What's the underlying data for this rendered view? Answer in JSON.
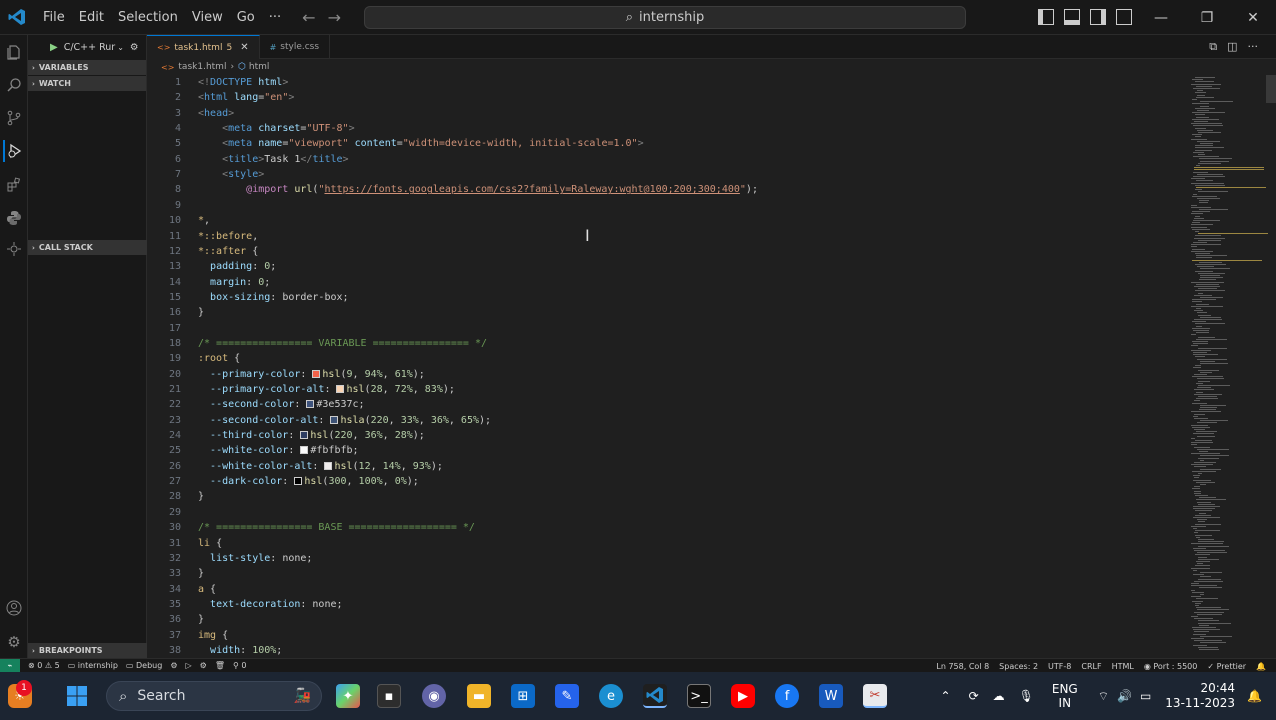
{
  "menu": [
    "File",
    "Edit",
    "Selection",
    "View",
    "Go",
    "···"
  ],
  "search": {
    "text": "internship"
  },
  "run": {
    "label": "C/C++ Rur"
  },
  "sidebar": {
    "sections": [
      {
        "label": "VARIABLES"
      },
      {
        "label": "WATCH"
      },
      {
        "label": "CALL STACK"
      },
      {
        "label": "BREAKPOINTS"
      }
    ]
  },
  "tabs": [
    {
      "label": "task1.html",
      "badge": "5",
      "icon": "html-file-icon",
      "active": true
    },
    {
      "label": "style.css",
      "icon": "css-file-icon",
      "active": false
    }
  ],
  "breadcrumb": {
    "file": "task1.html",
    "node": "html"
  },
  "code_lines": [
    {
      "n": "1",
      "spans": [
        [
          "t-punc",
          "<!"
        ],
        [
          "t-tag",
          "DOCTYPE "
        ],
        [
          "t-attr",
          "html"
        ],
        [
          "t-punc",
          ">"
        ]
      ]
    },
    {
      "n": "2",
      "spans": [
        [
          "t-punc",
          "<"
        ],
        [
          "t-tag",
          "html "
        ],
        [
          "t-attr",
          "lang"
        ],
        [
          "t-txt",
          "="
        ],
        [
          "t-str",
          "\"en\""
        ],
        [
          "t-punc",
          ">"
        ]
      ]
    },
    {
      "n": "3",
      "spans": [
        [
          "t-punc",
          "<"
        ],
        [
          "t-tag",
          "head"
        ],
        [
          "t-punc",
          ">"
        ]
      ]
    },
    {
      "n": "4",
      "spans": [
        [
          "t-txt",
          "    "
        ],
        [
          "t-punc",
          "<"
        ],
        [
          "t-tag",
          "meta "
        ],
        [
          "t-attr",
          "charset"
        ],
        [
          "t-txt",
          "="
        ],
        [
          "t-str",
          "\"UTF-8\""
        ],
        [
          "t-punc",
          ">"
        ]
      ]
    },
    {
      "n": "5",
      "spans": [
        [
          "t-txt",
          "    "
        ],
        [
          "t-punc",
          "<"
        ],
        [
          "t-tag",
          "meta "
        ],
        [
          "t-attr",
          "name"
        ],
        [
          "t-txt",
          "="
        ],
        [
          "t-str",
          "\"viewport\" "
        ],
        [
          "t-attr",
          "content"
        ],
        [
          "t-txt",
          "="
        ],
        [
          "t-str",
          "\"width=device-width, initial-scale=1.0\""
        ],
        [
          "t-punc",
          ">"
        ]
      ]
    },
    {
      "n": "6",
      "spans": [
        [
          "t-txt",
          "    "
        ],
        [
          "t-punc",
          "<"
        ],
        [
          "t-tag",
          "title"
        ],
        [
          "t-punc",
          ">"
        ],
        [
          "t-txt",
          "Task 1"
        ],
        [
          "t-punc",
          "</"
        ],
        [
          "t-tag",
          "title"
        ],
        [
          "t-punc",
          ">"
        ]
      ]
    },
    {
      "n": "7",
      "spans": [
        [
          "t-txt",
          "    "
        ],
        [
          "t-punc",
          "<"
        ],
        [
          "t-tag",
          "style"
        ],
        [
          "t-punc",
          ">"
        ]
      ]
    },
    {
      "n": "8",
      "spans": [
        [
          "t-txt",
          "        "
        ],
        [
          "t-kw",
          "@import "
        ],
        [
          "t-fn",
          "url"
        ],
        [
          "t-txt",
          "("
        ],
        [
          "t-str",
          "\""
        ],
        [
          "t-url",
          "https://fonts.googleapis.com/css2?family=Raleway:wght@100;200;300;400"
        ],
        [
          "t-str",
          "\""
        ],
        [
          "t-txt",
          ");"
        ]
      ]
    },
    {
      "n": "9",
      "spans": []
    },
    {
      "n": "10",
      "spans": [
        [
          "t-sel",
          "*"
        ],
        [
          "t-txt",
          ","
        ]
      ]
    },
    {
      "n": "11",
      "spans": [
        [
          "t-sel",
          "*::before"
        ],
        [
          "t-txt",
          ","
        ]
      ]
    },
    {
      "n": "12",
      "spans": [
        [
          "t-sel",
          "*::after"
        ],
        [
          "t-txt",
          " {"
        ]
      ]
    },
    {
      "n": "13",
      "spans": [
        [
          "t-txt",
          "  "
        ],
        [
          "t-prop",
          "padding"
        ],
        [
          "t-txt",
          ": "
        ],
        [
          "t-num",
          "0"
        ],
        [
          "t-txt",
          ";"
        ]
      ]
    },
    {
      "n": "14",
      "spans": [
        [
          "t-txt",
          "  "
        ],
        [
          "t-prop",
          "margin"
        ],
        [
          "t-txt",
          ": "
        ],
        [
          "t-num",
          "0"
        ],
        [
          "t-txt",
          ";"
        ]
      ]
    },
    {
      "n": "15",
      "spans": [
        [
          "t-txt",
          "  "
        ],
        [
          "t-prop",
          "box-sizing"
        ],
        [
          "t-txt",
          ": "
        ],
        [
          "t-txt",
          "border-box"
        ],
        [
          "t-txt",
          ";"
        ]
      ]
    },
    {
      "n": "16",
      "spans": [
        [
          "t-txt",
          "}"
        ]
      ]
    },
    {
      "n": "17",
      "spans": []
    },
    {
      "n": "18",
      "spans": [
        [
          "t-com",
          "/* ================ VARIABLE ================ */"
        ]
      ]
    },
    {
      "n": "19",
      "spans": [
        [
          "t-sel",
          ":root"
        ],
        [
          "t-txt",
          " {"
        ]
      ]
    },
    {
      "n": "20",
      "spans": [
        [
          "t-txt",
          "  "
        ],
        [
          "t-prop",
          "--primary-color"
        ],
        [
          "t-txt",
          ": "
        ],
        [
          "sw",
          "#f2624a"
        ],
        [
          "t-fn",
          "hsl"
        ],
        [
          "t-txt",
          "("
        ],
        [
          "t-num",
          "9"
        ],
        [
          "t-txt",
          ", "
        ],
        [
          "t-num",
          "94%"
        ],
        [
          "t-txt",
          ", "
        ],
        [
          "t-num",
          "61%"
        ],
        [
          "t-txt",
          ");"
        ]
      ]
    },
    {
      "n": "21",
      "spans": [
        [
          "t-txt",
          "  "
        ],
        [
          "t-prop",
          "--primary-color-alt"
        ],
        [
          "t-txt",
          ": "
        ],
        [
          "sw",
          "#f8d3b3"
        ],
        [
          "t-fn",
          "hsl"
        ],
        [
          "t-txt",
          "("
        ],
        [
          "t-num",
          "28"
        ],
        [
          "t-txt",
          ", "
        ],
        [
          "t-num",
          "72%"
        ],
        [
          "t-txt",
          ", "
        ],
        [
          "t-num",
          "83%"
        ],
        [
          "t-txt",
          ");"
        ]
      ]
    },
    {
      "n": "22",
      "spans": [
        [
          "t-txt",
          "  "
        ],
        [
          "t-prop",
          "--second-color"
        ],
        [
          "t-txt",
          ": "
        ],
        [
          "sw",
          "#3e537c"
        ],
        [
          "t-txt",
          "#3e537c"
        ],
        [
          "t-txt",
          ";"
        ]
      ]
    },
    {
      "n": "23",
      "spans": [
        [
          "t-txt",
          "  "
        ],
        [
          "t-prop",
          "--second-color-alt"
        ],
        [
          "t-txt",
          ": "
        ],
        [
          "sw",
          "#3d5275"
        ],
        [
          "t-fn",
          "hsla"
        ],
        [
          "t-txt",
          "("
        ],
        [
          "t-num",
          "220"
        ],
        [
          "t-txt",
          ", "
        ],
        [
          "t-num",
          "33%"
        ],
        [
          "t-txt",
          ", "
        ],
        [
          "t-num",
          "36%"
        ],
        [
          "t-txt",
          ", "
        ],
        [
          "t-num",
          "65%"
        ],
        [
          "t-txt",
          ");"
        ]
      ]
    },
    {
      "n": "24",
      "spans": [
        [
          "t-txt",
          "  "
        ],
        [
          "t-prop",
          "--third-color"
        ],
        [
          "t-txt",
          ": "
        ],
        [
          "sw",
          "#2e3d61"
        ],
        [
          "t-fn",
          "hsl"
        ],
        [
          "t-txt",
          "("
        ],
        [
          "t-num",
          "220"
        ],
        [
          "t-txt",
          ", "
        ],
        [
          "t-num",
          "36%"
        ],
        [
          "t-txt",
          ", "
        ],
        [
          "t-num",
          "28%"
        ],
        [
          "t-txt",
          ");"
        ]
      ]
    },
    {
      "n": "25",
      "spans": [
        [
          "t-txt",
          "  "
        ],
        [
          "t-prop",
          "--white-color"
        ],
        [
          "t-txt",
          ": "
        ],
        [
          "sw",
          "#fbfbfb"
        ],
        [
          "t-txt",
          "#fbfbfb"
        ],
        [
          "t-txt",
          ";"
        ]
      ]
    },
    {
      "n": "26",
      "spans": [
        [
          "t-txt",
          "  "
        ],
        [
          "t-prop",
          "--white-color-alt"
        ],
        [
          "t-txt",
          ": "
        ],
        [
          "sw",
          "#f0edec"
        ],
        [
          "t-fn",
          "hsl"
        ],
        [
          "t-txt",
          "("
        ],
        [
          "t-num",
          "12"
        ],
        [
          "t-txt",
          ", "
        ],
        [
          "t-num",
          "14%"
        ],
        [
          "t-txt",
          ", "
        ],
        [
          "t-num",
          "93%"
        ],
        [
          "t-txt",
          ");"
        ]
      ]
    },
    {
      "n": "27",
      "spans": [
        [
          "t-txt",
          "  "
        ],
        [
          "t-prop",
          "--dark-color"
        ],
        [
          "t-txt",
          ": "
        ],
        [
          "sw",
          "#000000"
        ],
        [
          "t-fn",
          "hsl"
        ],
        [
          "t-txt",
          "("
        ],
        [
          "t-num",
          "300"
        ],
        [
          "t-txt",
          ", "
        ],
        [
          "t-num",
          "100%"
        ],
        [
          "t-txt",
          ", "
        ],
        [
          "t-num",
          "0%"
        ],
        [
          "t-txt",
          ");"
        ]
      ]
    },
    {
      "n": "28",
      "spans": [
        [
          "t-txt",
          "}"
        ]
      ]
    },
    {
      "n": "29",
      "spans": []
    },
    {
      "n": "30",
      "spans": [
        [
          "t-com",
          "/* ================ BASE ================== */"
        ]
      ]
    },
    {
      "n": "31",
      "spans": [
        [
          "t-sel",
          "li"
        ],
        [
          "t-txt",
          " {"
        ]
      ]
    },
    {
      "n": "32",
      "spans": [
        [
          "t-txt",
          "  "
        ],
        [
          "t-prop",
          "list-style"
        ],
        [
          "t-txt",
          ": "
        ],
        [
          "t-txt",
          "none"
        ],
        [
          "t-txt",
          ";"
        ]
      ]
    },
    {
      "n": "33",
      "spans": [
        [
          "t-txt",
          "}"
        ]
      ]
    },
    {
      "n": "34",
      "spans": [
        [
          "t-sel",
          "a"
        ],
        [
          "t-txt",
          " {"
        ]
      ]
    },
    {
      "n": "35",
      "spans": [
        [
          "t-txt",
          "  "
        ],
        [
          "t-prop",
          "text-decoration"
        ],
        [
          "t-txt",
          ": "
        ],
        [
          "t-txt",
          "none"
        ],
        [
          "t-txt",
          ";"
        ]
      ]
    },
    {
      "n": "36",
      "spans": [
        [
          "t-txt",
          "}"
        ]
      ]
    },
    {
      "n": "37",
      "spans": [
        [
          "t-sel",
          "img"
        ],
        [
          "t-txt",
          " {"
        ]
      ]
    },
    {
      "n": "38",
      "spans": [
        [
          "t-txt",
          "  "
        ],
        [
          "t-prop",
          "width"
        ],
        [
          "t-txt",
          ": "
        ],
        [
          "t-num",
          "100%"
        ],
        [
          "t-txt",
          ";"
        ]
      ]
    }
  ],
  "status": {
    "remote": "⌁",
    "problems": "⊗ 0 ⚠ 5",
    "folder": "internship",
    "debug": "Debug",
    "ports": "0",
    "position": "Ln 758, Col 8",
    "spaces": "Spaces: 2",
    "encoding": "UTF-8",
    "eol": "CRLF",
    "language": "HTML",
    "port": "Port : 5500",
    "prettier": "✓ Prettier"
  },
  "taskbar": {
    "search_placeholder": "Search",
    "notification_badge": "1",
    "lang_line1": "ENG",
    "lang_line2": "IN",
    "time": "20:44",
    "date": "13-11-2023"
  },
  "colors": {
    "accent": "#0078d4",
    "remote": "#16825d",
    "taskbar": "#1c2532"
  }
}
